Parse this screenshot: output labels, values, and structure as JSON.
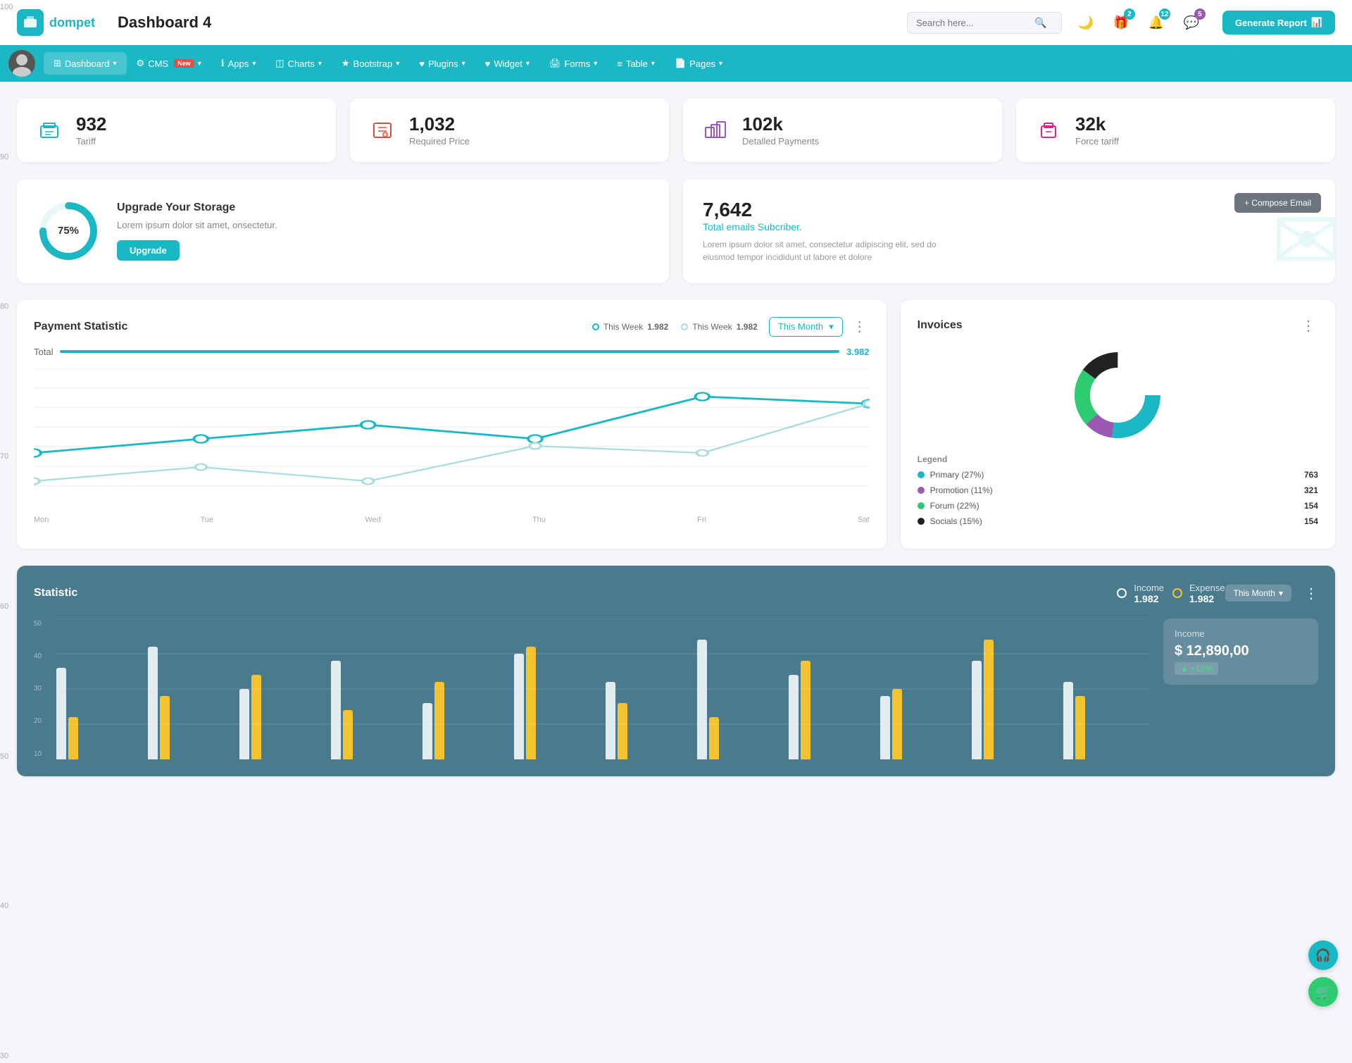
{
  "header": {
    "logo_text": "dompet",
    "page_title": "Dashboard 4",
    "search_placeholder": "Search here...",
    "icons": {
      "moon": "🌙",
      "gift": "🎁",
      "bell": "🔔",
      "chat": "💬"
    },
    "badges": {
      "gift": "2",
      "bell": "12",
      "chat": "5"
    },
    "generate_btn": "Generate Report"
  },
  "nav": {
    "items": [
      {
        "label": "Dashboard",
        "active": true,
        "has_arrow": true,
        "icon": "⊞"
      },
      {
        "label": "CMS",
        "active": false,
        "has_arrow": true,
        "icon": "⚙",
        "badge": "New"
      },
      {
        "label": "Apps",
        "active": false,
        "has_arrow": true,
        "icon": "ℹ"
      },
      {
        "label": "Charts",
        "active": false,
        "has_arrow": true,
        "icon": "◫"
      },
      {
        "label": "Bootstrap",
        "active": false,
        "has_arrow": true,
        "icon": "★"
      },
      {
        "label": "Plugins",
        "active": false,
        "has_arrow": true,
        "icon": "♥"
      },
      {
        "label": "Widget",
        "active": false,
        "has_arrow": true,
        "icon": "♥"
      },
      {
        "label": "Forms",
        "active": false,
        "has_arrow": true,
        "icon": "🖨"
      },
      {
        "label": "Table",
        "active": false,
        "has_arrow": true,
        "icon": "≡"
      },
      {
        "label": "Pages",
        "active": false,
        "has_arrow": true,
        "icon": "📄"
      }
    ]
  },
  "stat_cards": [
    {
      "value": "932",
      "label": "Tariff",
      "icon": "💼",
      "color": "#1ab8c4"
    },
    {
      "value": "1,032",
      "label": "Required Price",
      "icon": "📋",
      "color": "#e74c3c"
    },
    {
      "value": "102k",
      "label": "Detalled Payments",
      "icon": "🏢",
      "color": "#9b59b6"
    },
    {
      "value": "32k",
      "label": "Force tariff",
      "icon": "🏭",
      "color": "#e91e8c"
    }
  ],
  "storage": {
    "percent": "75%",
    "title": "Upgrade Your Storage",
    "desc": "Lorem ipsum dolor sit amet, onsectetur.",
    "btn_label": "Upgrade",
    "donut_pct": 75
  },
  "email": {
    "count": "7,642",
    "sub": "Total emails Subcriber.",
    "desc": "Lorem ipsum dolor sit amet, consectetur adipiscing elit, sed do eiusmod tempor incididunt ut labore et dolore",
    "compose_btn": "+ Compose Email"
  },
  "payment": {
    "title": "Payment Statistic",
    "legend": [
      {
        "label": "This Week",
        "value": "1.982",
        "color": "#1ab8c4"
      },
      {
        "label": "This Week",
        "value": "1.982",
        "color": "#cce9ed"
      }
    ],
    "month_selector": "This Month",
    "total_label": "Total",
    "total_value": "3.982",
    "x_labels": [
      "Mon",
      "Tue",
      "Wed",
      "Thu",
      "Fri",
      "Sat"
    ],
    "y_labels": [
      "100",
      "90",
      "80",
      "70",
      "60",
      "50",
      "40",
      "30"
    ],
    "line1": [
      60,
      70,
      80,
      65,
      90,
      85
    ],
    "line2": [
      40,
      50,
      40,
      65,
      60,
      90
    ]
  },
  "invoices": {
    "title": "Invoices",
    "legend": [
      {
        "label": "Primary (27%)",
        "value": "763",
        "color": "#1ab8c4"
      },
      {
        "label": "Promotion (11%)",
        "value": "321",
        "color": "#9b59b6"
      },
      {
        "label": "Forum (22%)",
        "value": "154",
        "color": "#2ecc71"
      },
      {
        "label": "Socials (15%)",
        "value": "154",
        "color": "#222"
      }
    ],
    "legend_title": "Legend"
  },
  "statistic": {
    "title": "Statistic",
    "month_btn": "This Month",
    "income_label": "Income",
    "income_value": "1.982",
    "expense_label": "Expense",
    "expense_value": "1.982",
    "income_box_label": "Income",
    "income_box_value": "$ 12,890,00",
    "income_badge": "+15%",
    "y_labels": [
      "50",
      "40",
      "30",
      "20",
      "10"
    ],
    "bars": [
      {
        "white": 65,
        "yellow": 30
      },
      {
        "white": 80,
        "yellow": 45
      },
      {
        "white": 50,
        "yellow": 60
      },
      {
        "white": 70,
        "yellow": 35
      },
      {
        "white": 40,
        "yellow": 55
      },
      {
        "white": 75,
        "yellow": 80
      },
      {
        "white": 55,
        "yellow": 40
      },
      {
        "white": 85,
        "yellow": 30
      },
      {
        "white": 60,
        "yellow": 70
      },
      {
        "white": 45,
        "yellow": 50
      },
      {
        "white": 70,
        "yellow": 85
      },
      {
        "white": 55,
        "yellow": 45
      }
    ]
  }
}
